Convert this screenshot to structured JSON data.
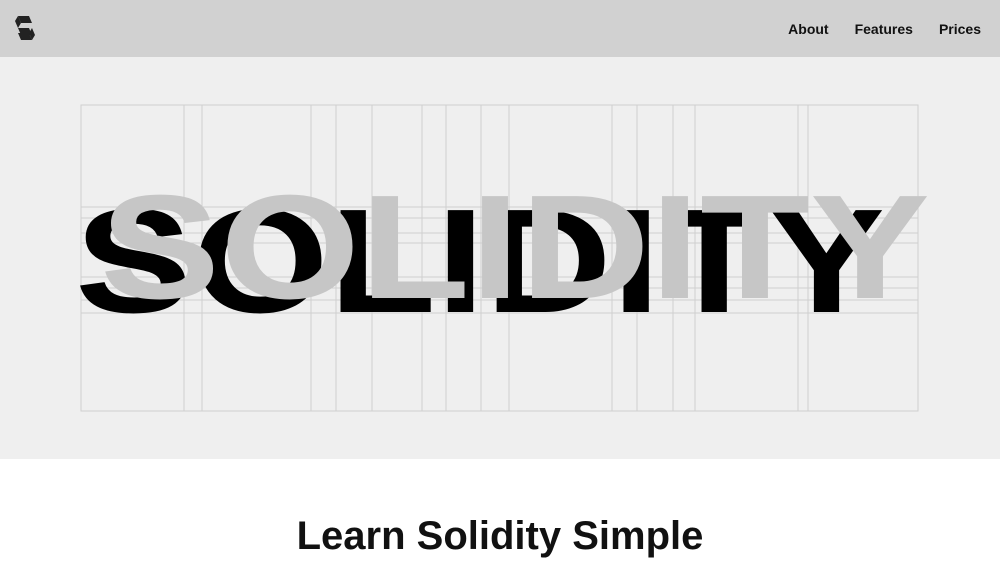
{
  "header": {
    "logo_icon": "solidity-s-logo-icon",
    "nav": [
      {
        "label": "About"
      },
      {
        "label": "Features"
      },
      {
        "label": "Prices"
      }
    ]
  },
  "hero": {
    "wordmark": "SOLIDITY",
    "shadow_color": "#000000",
    "front_color": "#c6c6c6",
    "grid_color": "#cfcfcf",
    "background": "#efefef"
  },
  "main": {
    "headline": "Learn Solidity Simple"
  }
}
